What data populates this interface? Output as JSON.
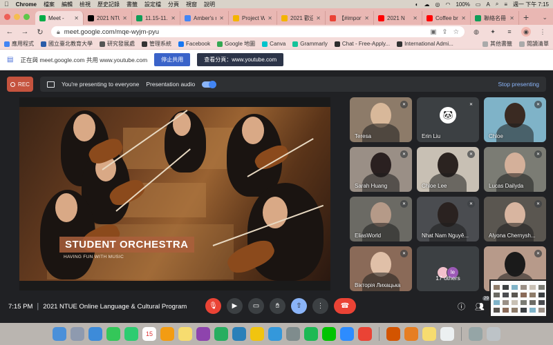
{
  "menubar": {
    "app_name": "Chrome",
    "menus": [
      "檔案",
      "編輯",
      "檢視",
      "歷史記錄",
      "書籤",
      "設定檔",
      "分頁",
      "視窗",
      "說明"
    ],
    "battery": "100%",
    "clock": "週一 下午 7:15",
    "input_method": "A"
  },
  "tabs": [
    {
      "title": "Meet - ",
      "color": "#00ac47",
      "active": true
    },
    {
      "title": "2021 NTUE",
      "color": "#000000"
    },
    {
      "title": "11.15-11.19",
      "color": "#0f9d58"
    },
    {
      "title": "Amber's n",
      "color": "#4285f4"
    },
    {
      "title": "Project W",
      "color": "#f4b400"
    },
    {
      "title": "2021 歡迎",
      "color": "#f4b400"
    },
    {
      "title": "【#import",
      "color": "#ea4335"
    },
    {
      "title": "2021 N",
      "color": "#ff0000"
    },
    {
      "title": "Coffee br",
      "color": "#ff0000"
    },
    {
      "title": "聯絡名冊",
      "color": "#0f9d58"
    }
  ],
  "address": {
    "url": "meet.google.com/mqe-wyjm-pyu"
  },
  "bookmarks": [
    {
      "label": "應用程式",
      "color": "#4285f4"
    },
    {
      "label": "國立臺北教育大學",
      "color": "#2a5ca8"
    },
    {
      "label": "研究發展處",
      "color": "#555555"
    },
    {
      "label": "管理系統",
      "color": "#333333"
    },
    {
      "label": "Facebook",
      "color": "#1877f2"
    },
    {
      "label": "Google 地圖",
      "color": "#34a853"
    },
    {
      "label": "Canva",
      "color": "#00c4cc"
    },
    {
      "label": "Grammarly",
      "color": "#15c39a"
    },
    {
      "label": "Chat - Free-Apply...",
      "color": "#2d2d2d"
    },
    {
      "label": "International Admi...",
      "color": "#333333"
    }
  ],
  "bookmarks_right": [
    "其他書籤",
    "閱讀清單"
  ],
  "share_notice": {
    "text": "正在與 meet.google.com 共用 www.youtube.com",
    "stop_label": "停止共用",
    "view_label": "查看分頁：www.youtube.com"
  },
  "meet": {
    "rec_label": "REC",
    "presenting_text": "You're presenting to everyone",
    "audio_label": "Presentation audio",
    "stop_label": "Stop presenting",
    "caption_title": "STUDENT ORCHESTRA",
    "caption_sub": "HAVING FUN WITH MUSIC"
  },
  "participants": [
    {
      "name": "Teresa",
      "bg": "#8d7b69",
      "head": "#d8b89a"
    },
    {
      "name": "Erin Liu",
      "bg": "#3c4043",
      "avatar": true
    },
    {
      "name": "Chloe",
      "bg": "#7fb3c8",
      "head": "#3a2a22"
    },
    {
      "name": "Sarah Huang",
      "bg": "#9a8f86",
      "head": "#2a2020"
    },
    {
      "name": "Chloe Lee",
      "bg": "#c8c0b4",
      "head": "#2b2320"
    },
    {
      "name": "Lucas Dailyda",
      "bg": "#7b7c74",
      "head": "#d4b09a"
    },
    {
      "name": "EliasWorld",
      "bg": "#6b6a64",
      "head": "#b59a88"
    },
    {
      "name": "Nhat Nam Nguyê...",
      "bg": "#4a4c50",
      "head": "#2a2220"
    },
    {
      "name": "Alyona Chernysh...",
      "bg": "#5a5650",
      "head": "#d8b5a0"
    },
    {
      "name": "Вікторія Лихацька",
      "bg": "#8a6a58",
      "head": "#e0c0a8"
    },
    {
      "name": "17 others",
      "bg": "#3c4043",
      "others": true
    },
    {
      "name": "",
      "bg": "#b79a8a",
      "head": "#1a1a1a"
    }
  ],
  "others_initials": [
    {
      "letter": "",
      "color": "#f2c1cc"
    },
    {
      "letter": "le",
      "color": "#9b59b6"
    }
  ],
  "controls": {
    "time": "7:15 PM",
    "meeting_name": "2021 NTUE Online Language & Cultural Program",
    "participant_count": "29"
  },
  "dock_apps": [
    {
      "name": "finder",
      "color": "#4a90d9"
    },
    {
      "name": "launchpad",
      "color": "#8e9aaf"
    },
    {
      "name": "safari",
      "color": "#3d8bd9"
    },
    {
      "name": "messages",
      "color": "#34c759"
    },
    {
      "name": "facetime",
      "color": "#2ecc71"
    },
    {
      "name": "calendar",
      "color": "#ffffff",
      "label": "15"
    },
    {
      "name": "photos",
      "color": "#f39c12"
    },
    {
      "name": "notes",
      "color": "#f7dc6f"
    },
    {
      "name": "podcasts",
      "color": "#8e44ad"
    },
    {
      "name": "numbers",
      "color": "#27ae60"
    },
    {
      "name": "keynote",
      "color": "#2980b9"
    },
    {
      "name": "pages",
      "color": "#f1c40f"
    },
    {
      "name": "appstore",
      "color": "#3498db"
    },
    {
      "name": "settings",
      "color": "#7f8c8d"
    },
    {
      "name": "spotify",
      "color": "#1db954"
    },
    {
      "name": "line",
      "color": "#00c300"
    },
    {
      "name": "zoom",
      "color": "#2d8cff"
    },
    {
      "name": "chrome",
      "color": "#ea4335"
    },
    {
      "name": "powerpoint",
      "color": "#d35400"
    },
    {
      "name": "office",
      "color": "#e67e22"
    },
    {
      "name": "stickies",
      "color": "#f7dc6f"
    },
    {
      "name": "preview",
      "color": "#ecf0f1"
    },
    {
      "name": "downloads",
      "color": "#95a5a6"
    },
    {
      "name": "trash",
      "color": "#bdc3c7"
    }
  ]
}
